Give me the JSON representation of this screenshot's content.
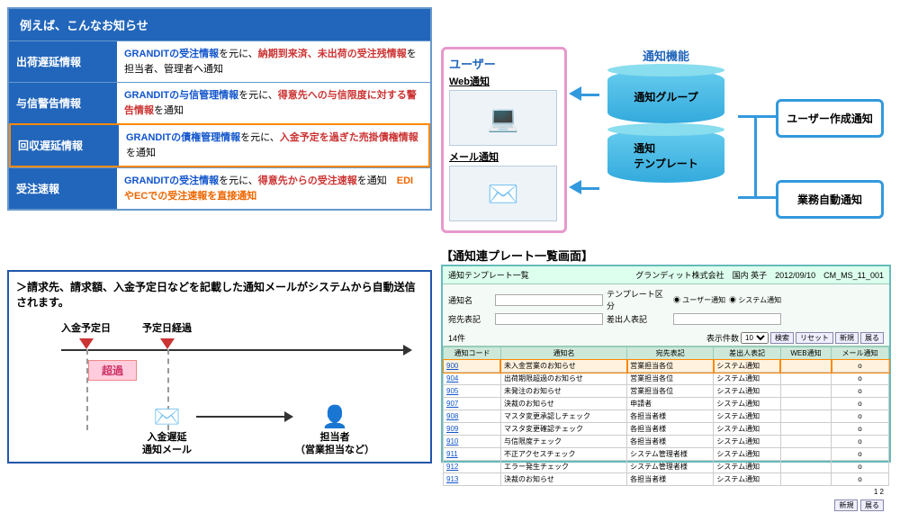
{
  "info": {
    "header": "例えば、こんなお知らせ",
    "rows": [
      {
        "label": "出荷遅延情報",
        "desc_pre": "GRANDITの受注情報",
        "desc_mid": "を元に、",
        "em": "納期到来済、未出荷の受注残情報",
        "desc_post": "を担当者、管理者へ通知",
        "em_class": "red"
      },
      {
        "label": "与信警告情報",
        "desc_pre": "GRANDITの与信管理情報",
        "desc_mid": "を元に、",
        "em": "得意先への与信限度に対する警告情報",
        "desc_post": "を通知",
        "em_class": "red"
      },
      {
        "label": "回収遅延情報",
        "desc_pre": "GRANDITの債権管理情報",
        "desc_mid": "を元に、",
        "em": "入金予定を過ぎた売掛債権情報",
        "desc_post": "を通知",
        "em_class": "red"
      },
      {
        "label": "受注速報",
        "desc_pre": "GRANDITの受注情報",
        "desc_mid": "を元に、",
        "em": "得意先からの受注速報",
        "desc_post": "を通知　",
        "em_class": "red",
        "extra": "EDIやECでの受注速報を直接通知"
      }
    ]
  },
  "user": {
    "title": "ユーザー",
    "web": "Web通知",
    "mail": "メール通知"
  },
  "notify": {
    "title": "通知機能",
    "group": "通知グループ",
    "template": "通知\nテンプレート"
  },
  "side": {
    "user_create": "ユーザー作成通知",
    "auto": "業務自動通知"
  },
  "screen_title": "【通知連プレート一覧画面】",
  "detail": {
    "text": "＞請求先、請求額、入金予定日などを記載した通知メールがシステムから自動送信されます。",
    "date1": "入金予定日",
    "date2": "予定日経過",
    "exceed": "超過",
    "mail_label": "入金遅延\n通知メール",
    "person_label": "担当者\n（営業担当など）"
  },
  "ss": {
    "title": "通知テンプレート一覧",
    "company": "グランディット株式会社　国内 英子　2012/09/10　CM_MS_11_001",
    "f_name": "通知名",
    "f_filter": "テンプレート区分",
    "r1": "ユーザー通知",
    "r2": "システム通知",
    "f_dest": "宛先表記",
    "f_dest2": "差出人表記",
    "count": "14件",
    "disp": "表示件数",
    "btn_search": "検索",
    "btn_reset": "リセット",
    "btn_new": "新規",
    "btn_clear": "展る",
    "cols": [
      "通知コード",
      "通知名",
      "宛先表記",
      "差出人表記",
      "WEB通知",
      "メール通知"
    ],
    "rows": [
      [
        "900",
        "未入金営業のお知らせ",
        "営業担当各位",
        "システム通知",
        "",
        "o"
      ],
      [
        "904",
        "出荷期限超過のお知らせ",
        "営業担当各位",
        "システム通知",
        "",
        "o"
      ],
      [
        "905",
        "未発注のお知らせ",
        "営業担当各位",
        "システム通知",
        "",
        "o"
      ],
      [
        "907",
        "決裁のお知らせ",
        "申請者",
        "システム通知",
        "",
        "o"
      ],
      [
        "908",
        "マスタ変更承認しチェック",
        "各担当者様",
        "システム通知",
        "",
        "o"
      ],
      [
        "909",
        "マスタ変更確認チェック",
        "各担当者様",
        "システム通知",
        "",
        "o"
      ],
      [
        "910",
        "与信限度チェック",
        "各担当者様",
        "システム通知",
        "",
        "o"
      ],
      [
        "911",
        "不正アクセスチェック",
        "システム管理者様",
        "システム通知",
        "",
        "o"
      ],
      [
        "912",
        "エラー発生チェック",
        "システム管理者様",
        "システム通知",
        "",
        "o"
      ],
      [
        "913",
        "決裁のお知らせ",
        "各担当者様",
        "システム通知",
        "",
        "o"
      ]
    ],
    "page": "1 2"
  }
}
